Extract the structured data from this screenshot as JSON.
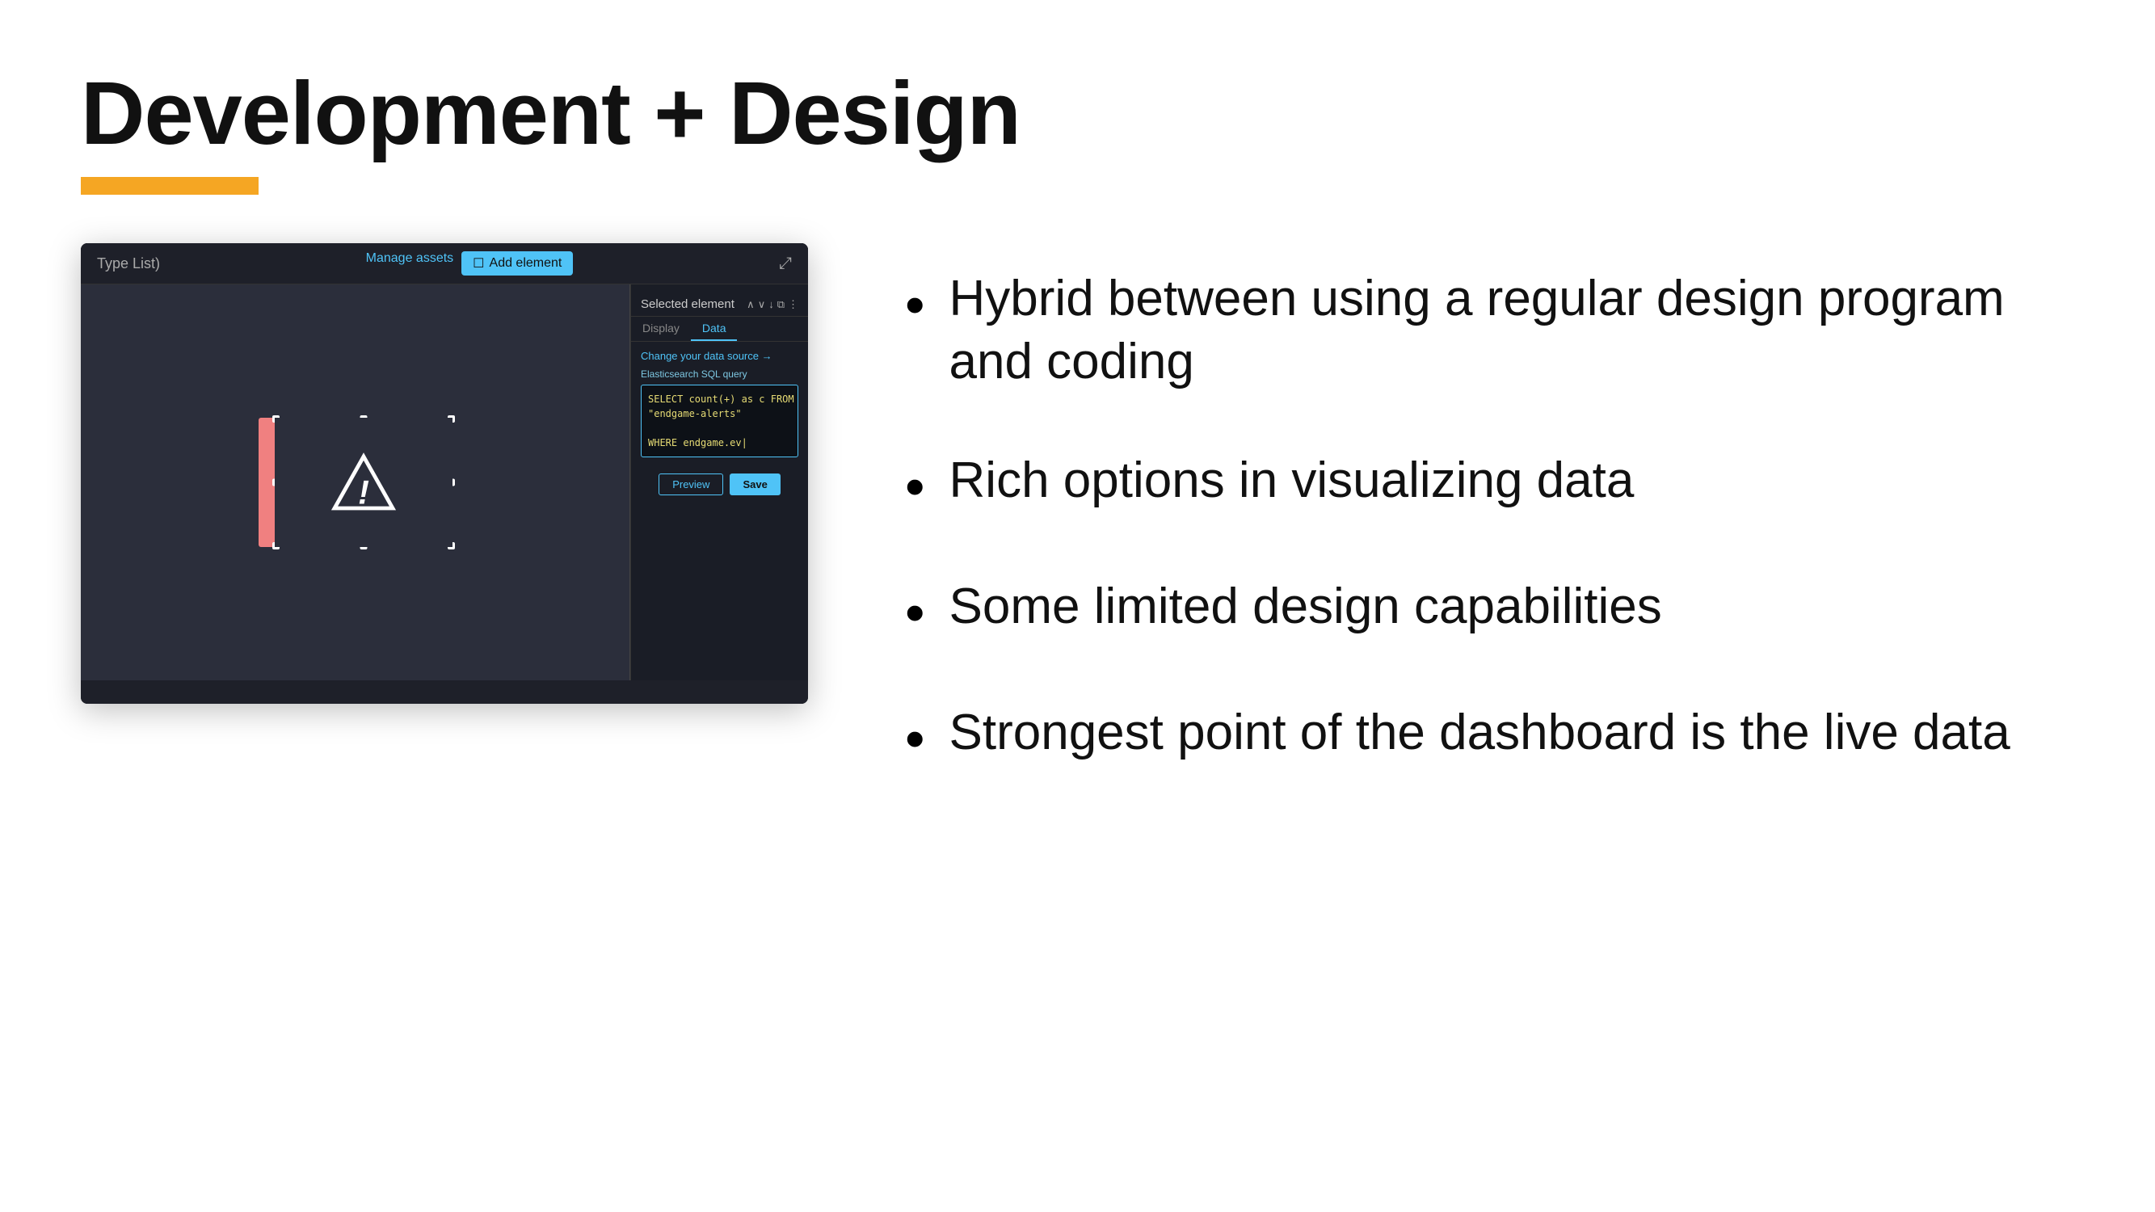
{
  "slide": {
    "title": "Development + Design",
    "underline_color": "#F5A623"
  },
  "screenshot": {
    "breadcrumb": "Type List)",
    "toolbar": {
      "manage_assets": "Manage assets",
      "add_element": "Add element",
      "add_icon": "+"
    },
    "panel": {
      "title": "Selected element",
      "tabs": [
        "Display",
        "Data"
      ],
      "active_tab": "Data",
      "data_source_link": "Change your data source →",
      "query_label": "Elasticsearch SQL query",
      "query_code": "SELECT count(+) as c FROM\n\"endgame-alerts\"\n\nWHERE endgame.ev|",
      "btn_preview": "Preview",
      "btn_save": "Save"
    }
  },
  "bullets": [
    {
      "text": "Hybrid between using a regular design program and coding"
    },
    {
      "text": "Rich options in visualizing data"
    },
    {
      "text": "Some limited design capabilities"
    },
    {
      "text": "Strongest point of the dashboard is the live data"
    }
  ]
}
